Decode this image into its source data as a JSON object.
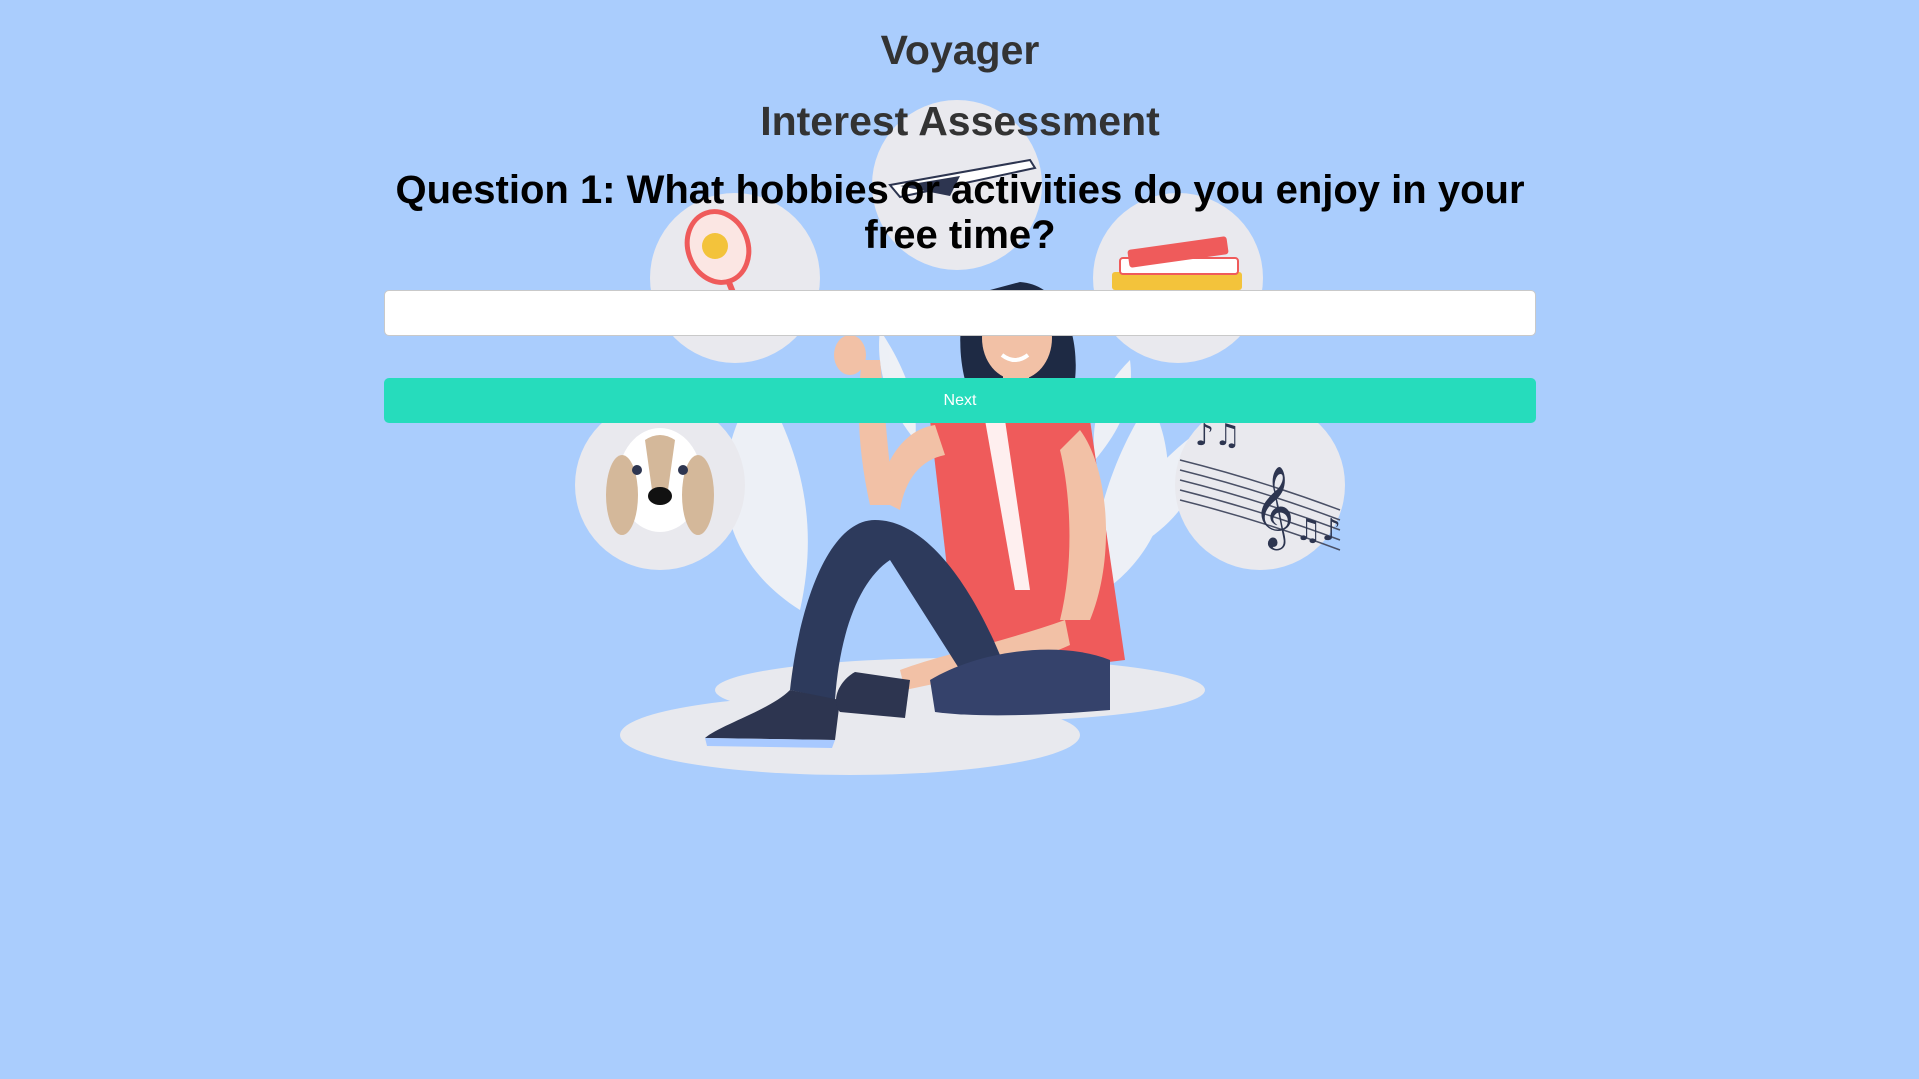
{
  "app": {
    "title": "Voyager"
  },
  "assessment": {
    "title": "Interest Assessment",
    "question": "Question 1: What hobbies or activities do you enjoy in your free time?",
    "answer_value": "",
    "answer_placeholder": "",
    "next_label": "Next"
  },
  "illustration": {
    "subject": "person-sitting-with-hobby-icons",
    "icons": [
      "airplane-icon",
      "tennis-racket-icon",
      "books-icon",
      "dog-icon",
      "music-notes-icon"
    ]
  },
  "colors": {
    "background": "#aacdfd",
    "accent_button": "#26dcbc",
    "heading": "#333333",
    "question": "#000000"
  }
}
